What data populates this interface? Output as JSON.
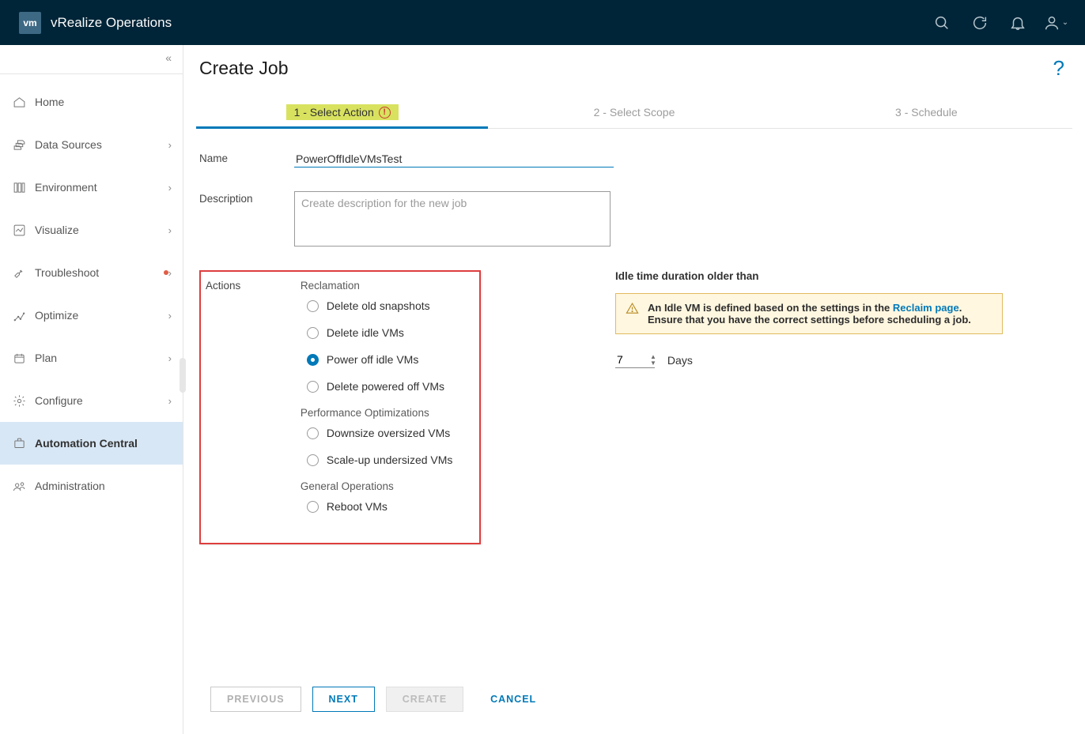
{
  "header": {
    "logo_text": "vm",
    "product": "vRealize Operations"
  },
  "sidebar": {
    "items": [
      {
        "id": "home",
        "label": "Home",
        "expandable": false
      },
      {
        "id": "data-sources",
        "label": "Data Sources",
        "expandable": true
      },
      {
        "id": "environment",
        "label": "Environment",
        "expandable": true
      },
      {
        "id": "visualize",
        "label": "Visualize",
        "expandable": true
      },
      {
        "id": "troubleshoot",
        "label": "Troubleshoot",
        "expandable": true,
        "dot": true
      },
      {
        "id": "optimize",
        "label": "Optimize",
        "expandable": true
      },
      {
        "id": "plan",
        "label": "Plan",
        "expandable": true
      },
      {
        "id": "configure",
        "label": "Configure",
        "expandable": true
      },
      {
        "id": "automation-central",
        "label": "Automation Central",
        "expandable": false
      },
      {
        "id": "administration",
        "label": "Administration",
        "expandable": false
      }
    ],
    "active": "automation-central"
  },
  "page": {
    "title": "Create Job",
    "steps": [
      {
        "label": "1 - Select Action",
        "active": true,
        "error": true
      },
      {
        "label": "2 - Select Scope",
        "active": false
      },
      {
        "label": "3 - Schedule",
        "active": false
      }
    ]
  },
  "form": {
    "name_label": "Name",
    "name_value": "PowerOffIdleVMsTest",
    "description_label": "Description",
    "description_placeholder": "Create description for the new job",
    "description_value": "",
    "actions_label": "Actions",
    "groups": [
      {
        "title": "Reclamation",
        "options": [
          {
            "id": "delete-old-snapshots",
            "label": "Delete old snapshots",
            "selected": false
          },
          {
            "id": "delete-idle-vms",
            "label": "Delete idle VMs",
            "selected": false
          },
          {
            "id": "power-off-idle-vms",
            "label": "Power off idle VMs",
            "selected": true
          },
          {
            "id": "delete-powered-off-vms",
            "label": "Delete powered off VMs",
            "selected": false
          }
        ]
      },
      {
        "title": "Performance Optimizations",
        "options": [
          {
            "id": "downsize-oversized-vms",
            "label": "Downsize oversized VMs",
            "selected": false
          },
          {
            "id": "scale-up-undersized-vms",
            "label": "Scale-up undersized VMs",
            "selected": false
          }
        ]
      },
      {
        "title": "General Operations",
        "options": [
          {
            "id": "reboot-vms",
            "label": "Reboot VMs",
            "selected": false
          }
        ]
      }
    ]
  },
  "detail": {
    "title": "Idle time duration older than",
    "alert_prefix": "An Idle VM is defined based on the settings in the ",
    "alert_link": "Reclaim page",
    "alert_suffix": ". Ensure that you have the correct settings before scheduling a job.",
    "days_value": "7",
    "days_unit": "Days"
  },
  "footer": {
    "previous": "PREVIOUS",
    "next": "NEXT",
    "create": "CREATE",
    "cancel": "CANCEL"
  }
}
